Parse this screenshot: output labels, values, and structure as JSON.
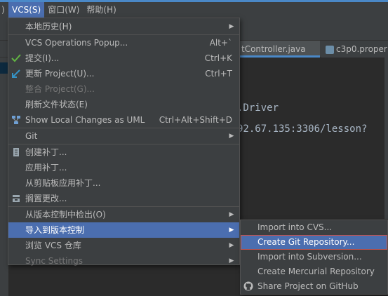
{
  "menubar": {
    "items": [
      {
        "label": ")"
      },
      {
        "label": "VCS(S)"
      },
      {
        "label": "窗口(W)"
      },
      {
        "label": "帮助(H)"
      }
    ]
  },
  "tabs": [
    {
      "label": "tController.java"
    },
    {
      "label": "c3p0.proper"
    }
  ],
  "code": {
    "line1": ".Driver",
    "line2": "92.67.135:3306/lesson?"
  },
  "vcs_menu": {
    "items": [
      {
        "label": "本地历史(H)"
      },
      {
        "label": "VCS Operations Popup...",
        "shortcut": "Alt+`"
      },
      {
        "label": "提交(I)...",
        "shortcut": "Ctrl+K"
      },
      {
        "label": "更新 Project(U)...",
        "shortcut": "Ctrl+T"
      },
      {
        "label": "整合 Project(G)..."
      },
      {
        "label": "刷新文件状态(E)"
      },
      {
        "label": "Show Local Changes as UML",
        "shortcut": "Ctrl+Alt+Shift+D"
      },
      {
        "label": "Git"
      },
      {
        "label": "创建补丁..."
      },
      {
        "label": "应用补丁..."
      },
      {
        "label": "从剪贴板应用补丁..."
      },
      {
        "label": "搁置更改..."
      },
      {
        "label": "从版本控制中检出(O)"
      },
      {
        "label": "导入到版本控制"
      },
      {
        "label": "浏览 VCS 仓库"
      },
      {
        "label": "Sync Settings"
      }
    ]
  },
  "import_submenu": {
    "items": [
      {
        "label": "Import into CVS..."
      },
      {
        "label": "Create Git Repository..."
      },
      {
        "label": "Import into Subversion..."
      },
      {
        "label": "Create Mercurial Repository"
      },
      {
        "label": "Share Project on GitHub"
      }
    ]
  },
  "colors": {
    "menu_bg": "#3c3f41",
    "highlight": "#4b6eaf",
    "selection_border": "#c75450",
    "editor_bg": "#2b2b2b"
  }
}
